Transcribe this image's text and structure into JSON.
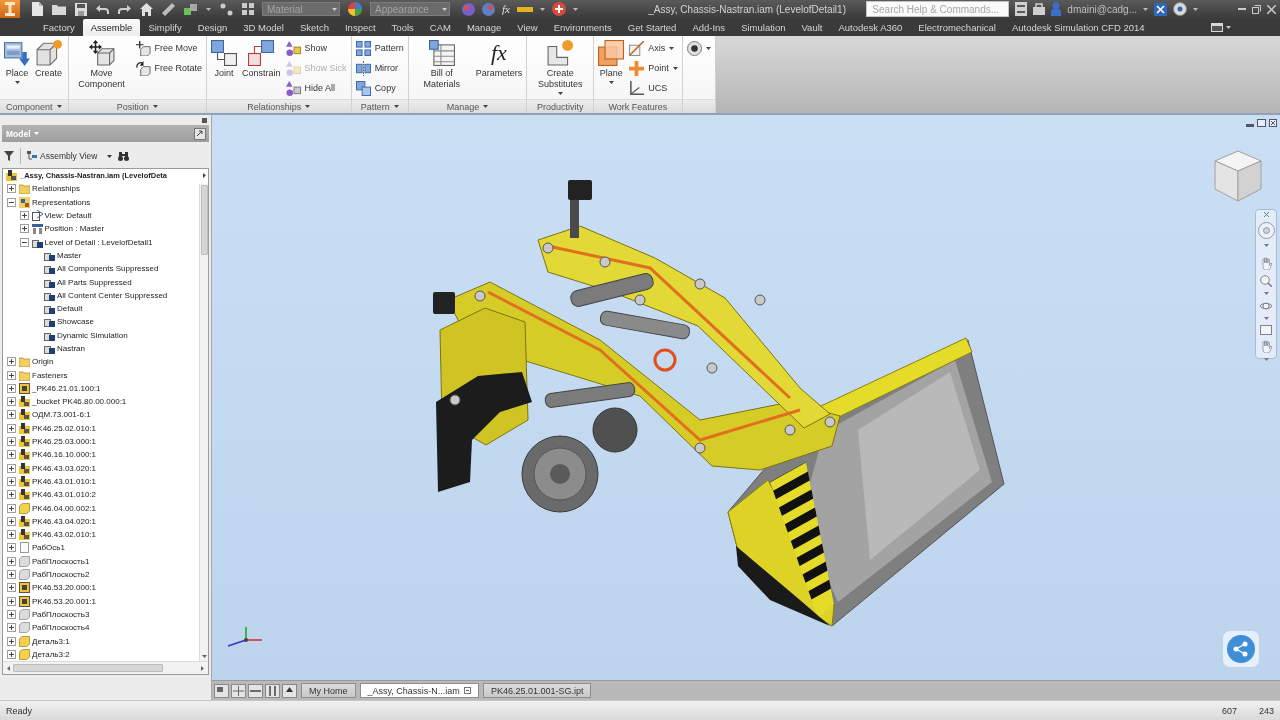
{
  "title_bar": {
    "material": {
      "placeholder": "Material"
    },
    "appearance": {
      "placeholder": "Appearance"
    },
    "formula": "fx",
    "title": "_Assy, Chassis-Nastran.iam (LevelofDetail1)",
    "search": {
      "placeholder": "Search Help & Commands..."
    },
    "user": "dmaini@cadg..."
  },
  "tabs": [
    {
      "label": "Factory",
      "selected": false
    },
    {
      "label": "Assemble",
      "selected": true
    },
    {
      "label": "Simplify",
      "selected": false
    },
    {
      "label": "Design",
      "selected": false
    },
    {
      "label": "3D Model",
      "selected": false
    },
    {
      "label": "Sketch",
      "selected": false
    },
    {
      "label": "Inspect",
      "selected": false
    },
    {
      "label": "Tools",
      "selected": false
    },
    {
      "label": "CAM",
      "selected": false
    },
    {
      "label": "Manage",
      "selected": false
    },
    {
      "label": "View",
      "selected": false
    },
    {
      "label": "Environments",
      "selected": false
    },
    {
      "label": "Get Started",
      "selected": false
    },
    {
      "label": "Add-Ins",
      "selected": false
    },
    {
      "label": "Simulation",
      "selected": false
    },
    {
      "label": "Vault",
      "selected": false
    },
    {
      "label": "Autodesk A360",
      "selected": false
    },
    {
      "label": "Electromechanical",
      "selected": false
    },
    {
      "label": "Autodesk Simulation CFD 2014",
      "selected": false
    }
  ],
  "ribbon": [
    {
      "title": "Component",
      "menu": true,
      "tools": [
        {
          "label": "Place",
          "kind": "large",
          "dropdown": true,
          "disabled": false
        },
        {
          "label": "Create",
          "kind": "large",
          "dropdown": false,
          "disabled": false
        }
      ]
    },
    {
      "title": "Position",
      "menu": true,
      "tools": [
        {
          "label": "Move Component",
          "kind": "large",
          "dropdown": false,
          "disabled": false
        },
        {
          "label": "Free Move",
          "kind": "small",
          "dropdown": false,
          "disabled": false
        },
        {
          "label": "Free Rotate",
          "kind": "small",
          "dropdown": false,
          "disabled": false
        }
      ]
    },
    {
      "title": "Relationships",
      "menu": true,
      "tools": [
        {
          "label": "Joint",
          "kind": "large",
          "dropdown": false,
          "disabled": false
        },
        {
          "label": "Constrain",
          "kind": "large",
          "dropdown": false,
          "disabled": false
        },
        {
          "label": "Show",
          "kind": "small",
          "dropdown": false,
          "disabled": false
        },
        {
          "label": "Show Sick",
          "kind": "small",
          "dropdown": false,
          "disabled": true
        },
        {
          "label": "Hide All",
          "kind": "small",
          "dropdown": false,
          "disabled": false
        }
      ]
    },
    {
      "title": "Pattern",
      "menu": true,
      "tools": [
        {
          "label": "Pattern",
          "kind": "small",
          "dropdown": false,
          "disabled": false
        },
        {
          "label": "Mirror",
          "kind": "small",
          "dropdown": false,
          "disabled": false
        },
        {
          "label": "Copy",
          "kind": "small",
          "dropdown": false,
          "disabled": false
        }
      ]
    },
    {
      "title": "Manage",
      "menu": true,
      "tools": [
        {
          "label": "Bill of Materials",
          "kind": "large",
          "dropdown": false,
          "disabled": false
        },
        {
          "label": "Parameters",
          "symbol": "fx",
          "kind": "large",
          "dropdown": false,
          "disabled": false
        }
      ]
    },
    {
      "title": "Productivity",
      "menu": false,
      "tools": [
        {
          "label": "Create Substitutes",
          "kind": "large",
          "dropdown": true,
          "disabled": false
        }
      ]
    },
    {
      "title": "Work Features",
      "menu": false,
      "tools": [
        {
          "label": "Plane",
          "kind": "large",
          "dropdown": true,
          "disabled": false
        },
        {
          "label": "Axis",
          "kind": "small",
          "dropdown": true,
          "disabled": false
        },
        {
          "label": "Point",
          "kind": "small",
          "dropdown": true,
          "disabled": false
        },
        {
          "label": "UCS",
          "kind": "small",
          "dropdown": false,
          "disabled": false
        }
      ]
    },
    {
      "menu": false,
      "tools": [
        {
          "kind": "small",
          "dropdown": true,
          "disabled": false
        }
      ]
    }
  ],
  "browser": {
    "title": "Model",
    "view": "Assembly View",
    "tree": {
      "label": "_Assy, Chassis-Nastran.iam (LevelofDeta",
      "kind": "block",
      "children": [
        {
          "label": "Relationships",
          "kind": "folder",
          "expanded": false
        },
        {
          "label": "Representations",
          "kind": "representation",
          "expanded": true,
          "children": [
            {
              "label": "View: Default",
              "kind": "view",
              "expanded": false
            },
            {
              "label": "Position : Master",
              "kind": "position",
              "expanded": false
            },
            {
              "label": "Level of Detail : LevelofDetail1",
              "kind": "lod",
              "expanded": true,
              "children": [
                {
                  "label": "Master",
                  "kind": "lod"
                },
                {
                  "label": "All Components Suppressed",
                  "kind": "lod"
                },
                {
                  "label": "All Parts Suppressed",
                  "kind": "lod"
                },
                {
                  "label": "All Content Center Suppressed",
                  "kind": "lod"
                },
                {
                  "label": "Default",
                  "kind": "lod"
                },
                {
                  "label": "Showcase",
                  "kind": "lod"
                },
                {
                  "label": "Dynamic Simulation",
                  "kind": "lod"
                },
                {
                  "label": "Nastran",
                  "kind": "lod"
                }
              ]
            }
          ]
        },
        {
          "label": "Origin",
          "kind": "folder",
          "expanded": false
        },
        {
          "label": "Fasteners",
          "kind": "folder",
          "expanded": false
        },
        {
          "label": "_PK46.21.01.100:1",
          "kind": "frame",
          "expanded": false
        },
        {
          "label": "_bucket PK46.80.00.000:1",
          "kind": "block",
          "expanded": false
        },
        {
          "label": "ОДМ.73.001-6:1",
          "kind": "block",
          "expanded": false
        },
        {
          "label": "PK46.25.02.010:1",
          "kind": "block",
          "expanded": false
        },
        {
          "label": "PK46.25.03.000:1",
          "kind": "block",
          "expanded": false
        },
        {
          "label": "PK46.16.10.000:1",
          "kind": "block",
          "expanded": false
        },
        {
          "label": "PK46.43.03.020:1",
          "kind": "block",
          "expanded": false
        },
        {
          "label": "PK46.43.01.010:1",
          "kind": "block",
          "expanded": false
        },
        {
          "label": "PK46.43.01.010:2",
          "kind": "block",
          "expanded": false
        },
        {
          "label": "PK46.04.00.002:1",
          "kind": "part",
          "expanded": false
        },
        {
          "label": "PK46.43.04.020:1",
          "kind": "block",
          "expanded": false
        },
        {
          "label": "PK46.43.02.010:1",
          "kind": "block",
          "expanded": false
        },
        {
          "label": "РабОсь1",
          "kind": "axis",
          "expanded": false
        },
        {
          "label": "РабПлоскость1",
          "kind": "plane",
          "expanded": false
        },
        {
          "label": "РабПлоскость2",
          "kind": "plane",
          "expanded": false
        },
        {
          "label": "PK46.53.20.000:1",
          "kind": "frame",
          "expanded": false
        },
        {
          "label": "PK46.53.20.001:1",
          "kind": "frame",
          "expanded": false
        },
        {
          "label": "РабПлоскость3",
          "kind": "plane",
          "expanded": false
        },
        {
          "label": "РабПлоскость4",
          "kind": "plane",
          "expanded": false
        },
        {
          "label": "Деталь3:1",
          "kind": "part",
          "expanded": false
        },
        {
          "label": "Деталь3:2",
          "kind": "part",
          "expanded": false
        }
      ]
    }
  },
  "document_tabs": [
    {
      "label": "My Home",
      "selected": false
    },
    {
      "label": "_Assy, Chassis-N...iam",
      "selected": true
    },
    {
      "label": "PK46.25.01.001-SG.ipt",
      "selected": false
    }
  ],
  "status_bar": {
    "message": "Ready",
    "values": [
      "607",
      "243"
    ]
  }
}
